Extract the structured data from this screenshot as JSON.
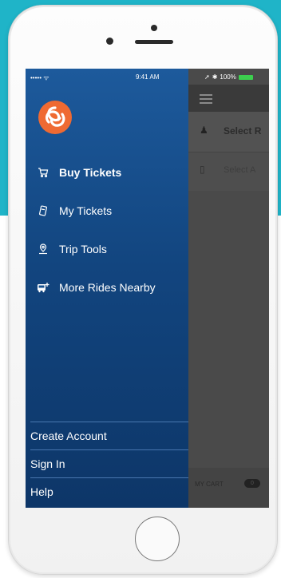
{
  "status_bar": {
    "signal": "••••• ᯤ",
    "time": "9:41 AM",
    "right": "100%"
  },
  "drawer": {
    "menu_items": [
      {
        "label": "Buy Tickets",
        "icon": "cart-icon",
        "active": true
      },
      {
        "label": "My Tickets",
        "icon": "ticket-icon",
        "active": false
      },
      {
        "label": "Trip Tools",
        "icon": "location-pin-icon",
        "active": false
      },
      {
        "label": "More Rides Nearby",
        "icon": "bus-plus-icon",
        "active": false
      }
    ],
    "bottom_links": [
      {
        "label": "Create Account"
      },
      {
        "label": "Sign In"
      },
      {
        "label": "Help"
      }
    ]
  },
  "behind": {
    "row1_text": "Select R",
    "row2_text": "Select A",
    "cart_label": "MY CART",
    "cart_count": "0"
  },
  "colors": {
    "accent_teal": "#1fb4c8",
    "drawer_blue": "#1d5a9c",
    "logo_orange": "#ef6a32"
  }
}
